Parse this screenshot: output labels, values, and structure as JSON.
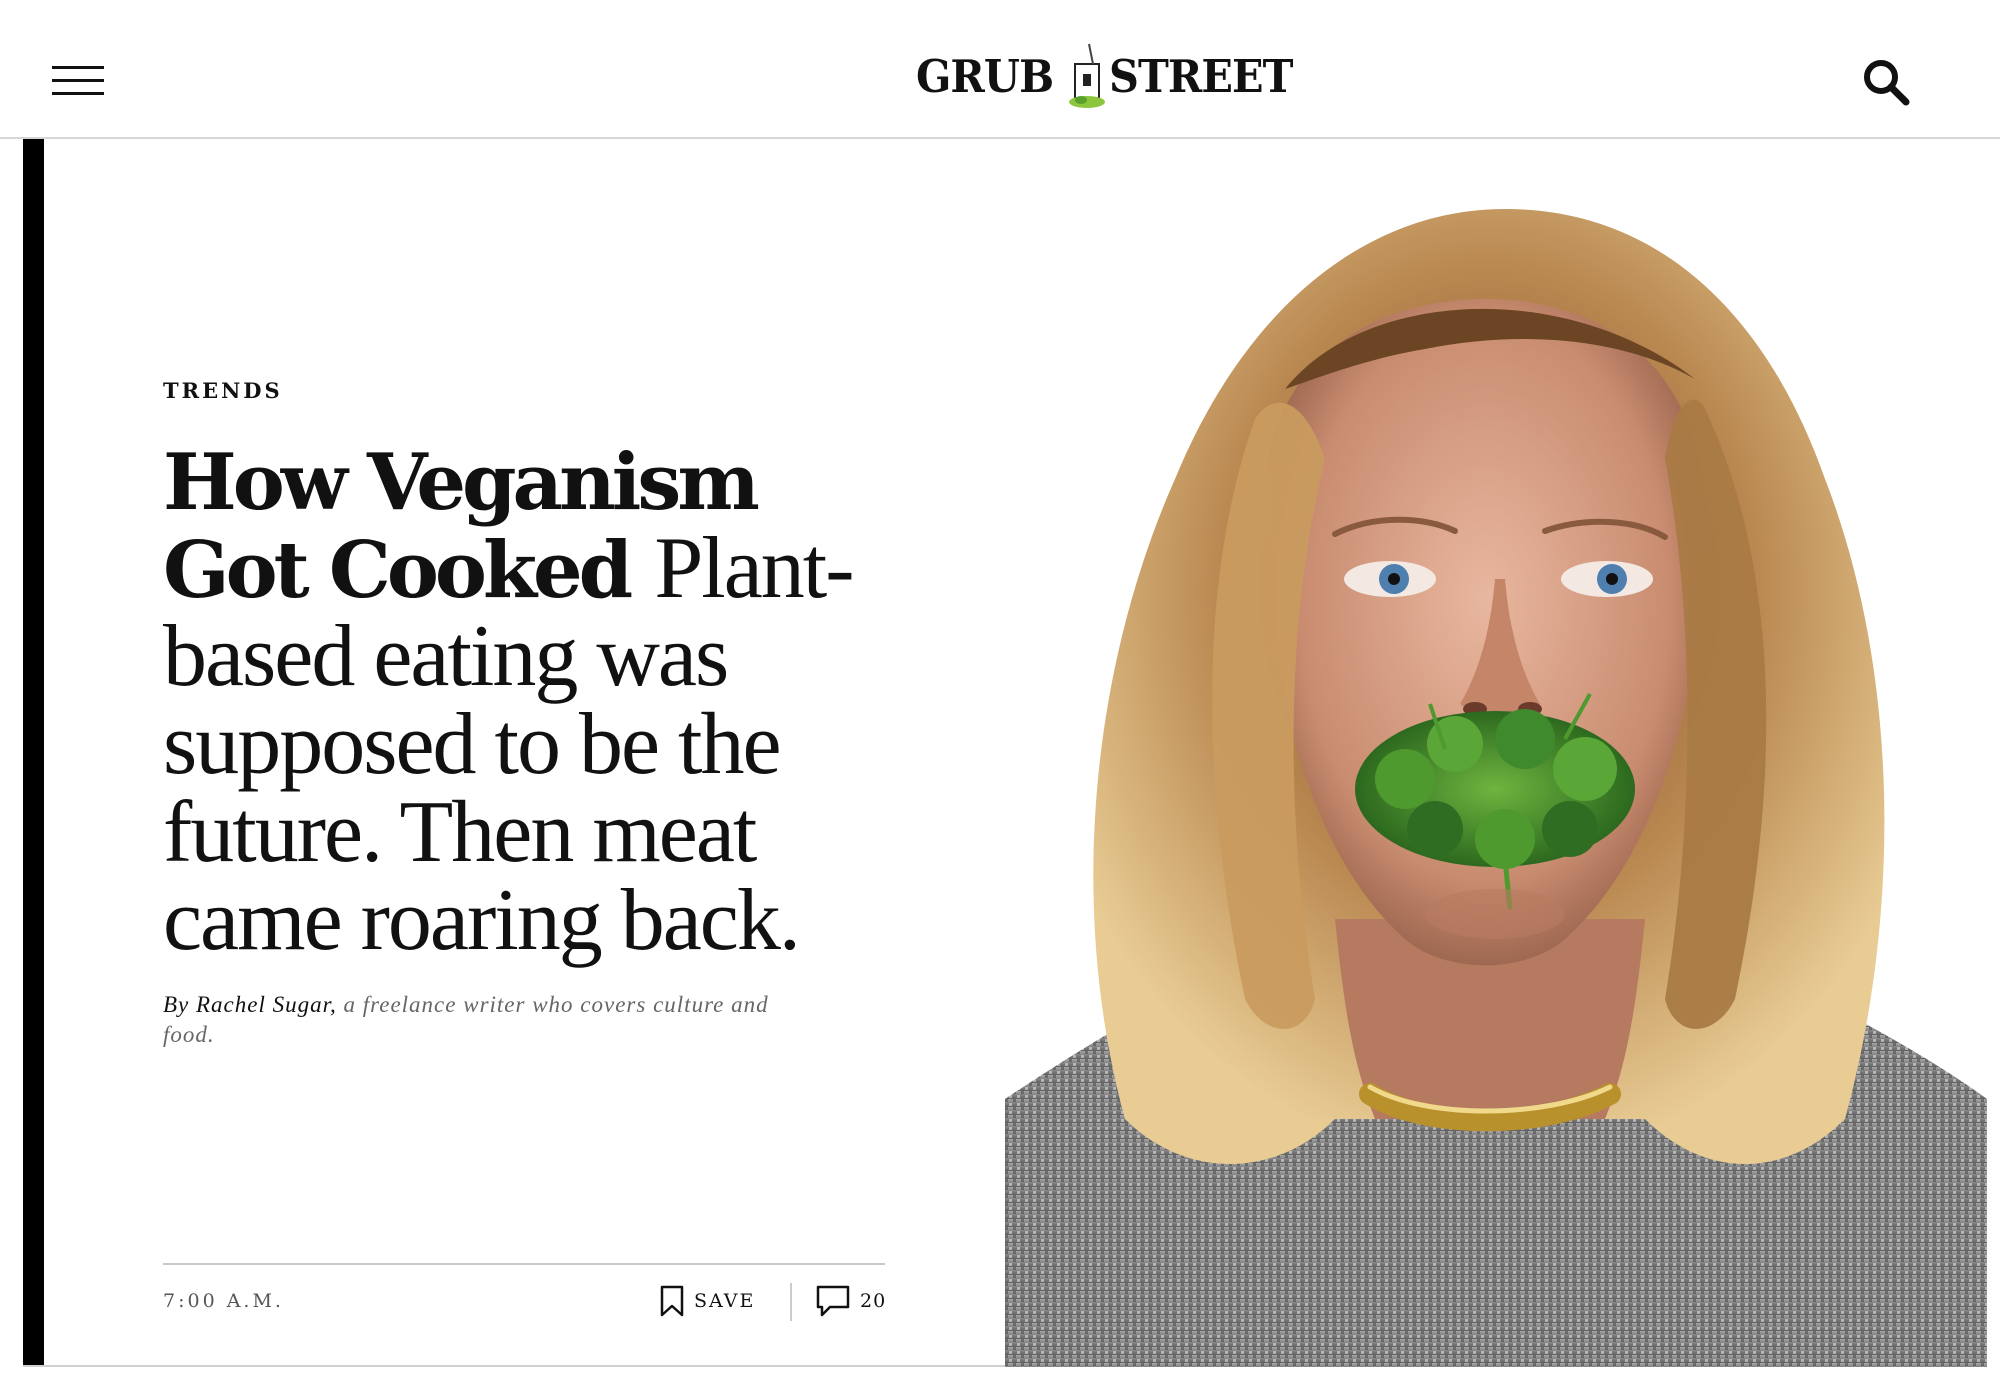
{
  "header": {
    "logo_left": "GRUB",
    "logo_right": "STREET",
    "menu_icon": "hamburger-menu-icon",
    "search_icon": "search-icon"
  },
  "article": {
    "rubric": "TRENDS",
    "headline": "How Veganism Got Cooked",
    "dek": "Plant-based eating was supposed to be the future. Then meat came roaring back.",
    "byline_prefix": "By Rachel Sugar,",
    "byline_bio": "a freelance writer who covers culture and food.",
    "timestamp": "7:00 A.M.",
    "save_label": "SAVE",
    "comment_count": "20"
  },
  "hero": {
    "description_icon": "portrait-photo",
    "colors": {
      "hair": "#b8864f",
      "skin": "#d9a48a",
      "greens": "#3f8a2c",
      "jacket": "#8c8c8c"
    }
  }
}
